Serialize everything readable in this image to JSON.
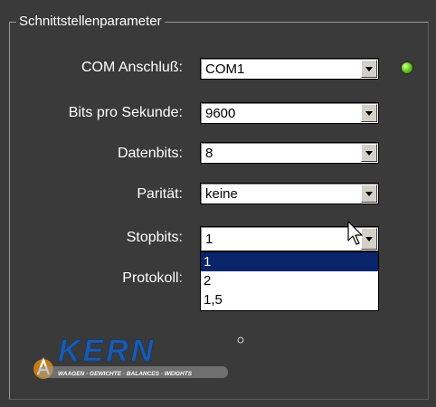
{
  "group": {
    "title": "Schnittstellenparameter"
  },
  "fields": [
    {
      "label": "COM Anschluß:",
      "value": "COM1"
    },
    {
      "label": "Bits pro Sekunde:",
      "value": "9600"
    },
    {
      "label": "Datenbits:",
      "value": "8"
    },
    {
      "label": "Parität:",
      "value": "keine"
    },
    {
      "label": "Stopbits:",
      "value": "1"
    },
    {
      "label": "Protokoll:"
    }
  ],
  "stopbits_dropdown": {
    "options": [
      "1",
      "2",
      "1,5"
    ],
    "selected_index": 0
  },
  "status_led": {
    "state": "connected",
    "color": "#6ad020"
  },
  "logo": {
    "brand": "KERN",
    "tagline": "WAAGEN · GEWICHTE · BALANCES · WEIGHTS",
    "brand_color": "#1e5aa8",
    "badge_color": "#d08a1e"
  },
  "colors": {
    "background": "#3a3a3a",
    "selection": "#0a246a"
  }
}
